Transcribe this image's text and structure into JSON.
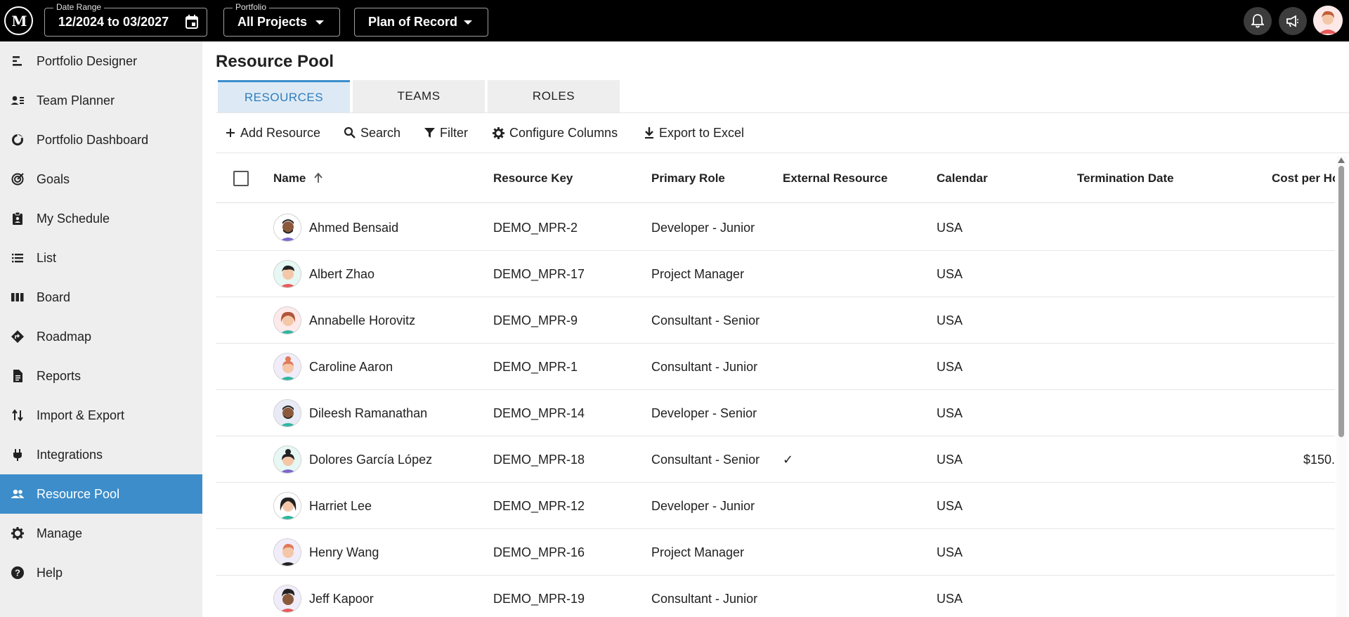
{
  "topbar": {
    "logo_text": "M",
    "date_range": {
      "label": "Date Range",
      "value": "12/2024 to 03/2027"
    },
    "portfolio": {
      "label": "Portfolio",
      "value": "All Projects"
    },
    "plan": {
      "value": "Plan of Record"
    },
    "icons": [
      "bell-icon",
      "megaphone-icon",
      "user-avatar"
    ]
  },
  "sidebar": {
    "items": [
      {
        "label": "Portfolio Designer",
        "icon": "portfolio-designer-icon"
      },
      {
        "label": "Team Planner",
        "icon": "team-planner-icon"
      },
      {
        "label": "Portfolio Dashboard",
        "icon": "dashboard-icon"
      },
      {
        "label": "Goals",
        "icon": "goals-icon"
      },
      {
        "label": "My Schedule",
        "icon": "schedule-icon"
      },
      {
        "label": "List",
        "icon": "list-icon"
      },
      {
        "label": "Board",
        "icon": "board-icon"
      },
      {
        "label": "Roadmap",
        "icon": "roadmap-icon"
      },
      {
        "label": "Reports",
        "icon": "reports-icon"
      },
      {
        "label": "Import & Export",
        "icon": "import-export-icon"
      },
      {
        "label": "Integrations",
        "icon": "plug-icon"
      },
      {
        "label": "Resource Pool",
        "icon": "people-icon",
        "active": true
      },
      {
        "label": "Manage",
        "icon": "gear-icon"
      },
      {
        "label": "Help",
        "icon": "help-icon"
      }
    ],
    "active_color": "#3c8dca"
  },
  "main": {
    "title": "Resource Pool",
    "tabs": [
      {
        "label": "RESOURCES",
        "active": true
      },
      {
        "label": "TEAMS"
      },
      {
        "label": "ROLES"
      }
    ],
    "toolbar": {
      "add": "Add Resource",
      "search": "Search",
      "filter": "Filter",
      "configure": "Configure Columns",
      "export": "Export to Excel"
    },
    "columns": {
      "name": "Name",
      "key": "Resource Key",
      "role": "Primary Role",
      "external": "External Resource",
      "calendar": "Calendar",
      "termination": "Termination Date",
      "cost": "Cost per Ho"
    },
    "rows": [
      {
        "name": "Ahmed Bensaid",
        "key": "DEMO_MPR-2",
        "role": "Developer - Junior",
        "external": "",
        "calendar": "USA",
        "termination": "",
        "cost": ""
      },
      {
        "name": "Albert Zhao",
        "key": "DEMO_MPR-17",
        "role": "Project Manager",
        "external": "",
        "calendar": "USA",
        "termination": "",
        "cost": ""
      },
      {
        "name": "Annabelle Horovitz",
        "key": "DEMO_MPR-9",
        "role": "Consultant - Senior",
        "external": "",
        "calendar": "USA",
        "termination": "",
        "cost": ""
      },
      {
        "name": "Caroline Aaron",
        "key": "DEMO_MPR-1",
        "role": "Consultant - Junior",
        "external": "",
        "calendar": "USA",
        "termination": "",
        "cost": ""
      },
      {
        "name": "Dileesh Ramanathan",
        "key": "DEMO_MPR-14",
        "role": "Developer - Senior",
        "external": "",
        "calendar": "USA",
        "termination": "",
        "cost": ""
      },
      {
        "name": "Dolores García López",
        "key": "DEMO_MPR-18",
        "role": "Consultant - Senior",
        "external": "✓",
        "calendar": "USA",
        "termination": "",
        "cost": "$150."
      },
      {
        "name": "Harriet Lee",
        "key": "DEMO_MPR-12",
        "role": "Developer - Junior",
        "external": "",
        "calendar": "USA",
        "termination": "",
        "cost": ""
      },
      {
        "name": "Henry Wang",
        "key": "DEMO_MPR-16",
        "role": "Project Manager",
        "external": "",
        "calendar": "USA",
        "termination": "",
        "cost": ""
      },
      {
        "name": "Jeff Kapoor",
        "key": "DEMO_MPR-19",
        "role": "Consultant - Junior",
        "external": "",
        "calendar": "USA",
        "termination": "",
        "cost": ""
      }
    ]
  }
}
